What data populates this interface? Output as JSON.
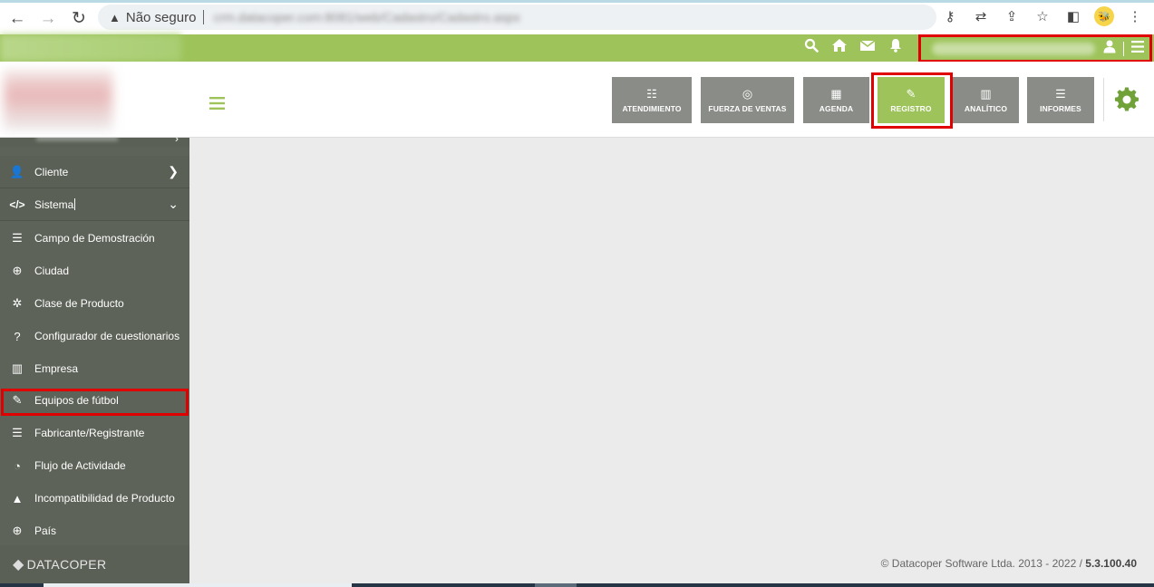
{
  "browser": {
    "back": "←",
    "forward": "→",
    "reload": "↻",
    "security_warning": "▲",
    "security_label": "Não seguro",
    "url": "crm.datacoper.com:8081/web/Cadastro/Cadastro.aspx"
  },
  "topbar": {
    "icons": [
      "search-icon",
      "home-icon",
      "mail-icon",
      "bell-icon"
    ],
    "user_name": "Alex Quadros Rodrigues Lucio"
  },
  "modules": [
    {
      "label": "ATENDIMIENTO",
      "icon": "☷",
      "active": false
    },
    {
      "label": "FUERZA DE VENTAS",
      "icon": "◎",
      "active": false
    },
    {
      "label": "AGENDA",
      "icon": "▦",
      "active": false
    },
    {
      "label": "REGISTRO",
      "icon": "✎",
      "active": true
    },
    {
      "label": "ANALÍTICO",
      "icon": "▥",
      "active": false
    },
    {
      "label": "INFORMES",
      "icon": "☰",
      "active": false
    }
  ],
  "sidebar": {
    "items": [
      {
        "label": "Cliente",
        "icon": "👤"
      },
      {
        "label": "Sistema",
        "icon": "</>"
      }
    ],
    "subitems": [
      {
        "label": "Campo de Demostración",
        "icon": "☰"
      },
      {
        "label": "Ciudad",
        "icon": "⊕"
      },
      {
        "label": "Clase de Producto",
        "icon": "✲"
      },
      {
        "label": "Configurador de cuestionarios",
        "icon": "?"
      },
      {
        "label": "Empresa",
        "icon": "▥"
      },
      {
        "label": "Equipos de fútbol",
        "icon": "✎"
      },
      {
        "label": "Fabricante/Registrante",
        "icon": "☰"
      },
      {
        "label": "Flujo de Actividade",
        "icon": "◔"
      },
      {
        "label": "Incompatibilidad de Producto",
        "icon": "▲"
      },
      {
        "label": "País",
        "icon": "⊕"
      }
    ],
    "brand": "DATACOPER"
  },
  "footer": {
    "copyright": "© Datacoper Software Ltda. 2013 - 2022 / ",
    "version": "5.3.100.40"
  }
}
